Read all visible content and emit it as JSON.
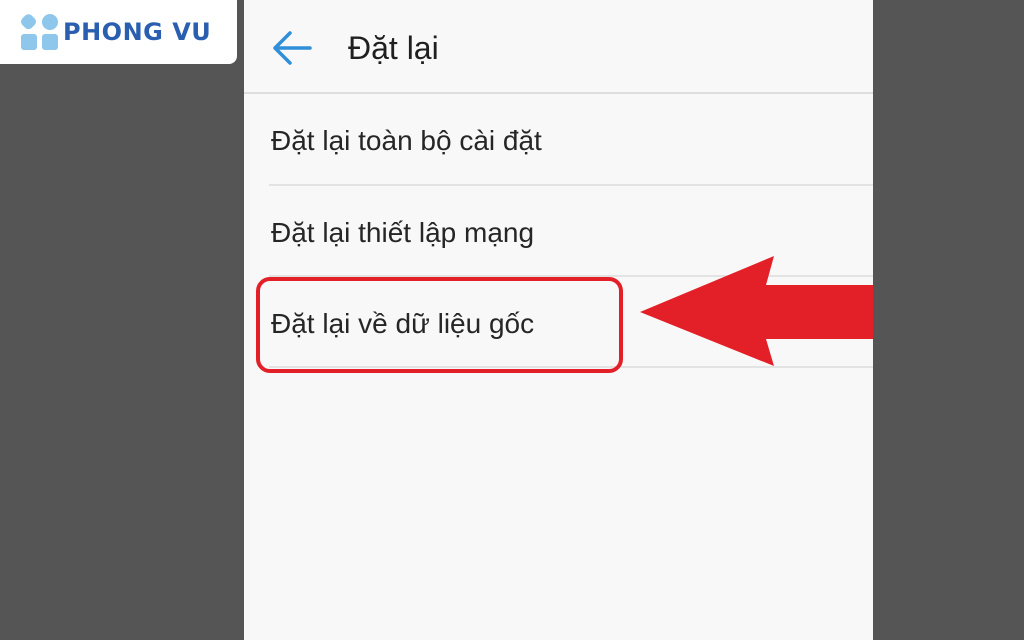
{
  "brand": {
    "name": "PHONG VU",
    "color": "#2a5fb0",
    "accent": "#8ec6ec"
  },
  "header": {
    "back_icon": "arrow-left-icon",
    "title": "Đặt lại"
  },
  "menu": {
    "items": [
      {
        "label": "Đặt lại toàn bộ cài đặt"
      },
      {
        "label": "Đặt lại thiết lập mạng"
      },
      {
        "label": "Đặt lại về dữ liệu gốc"
      }
    ]
  },
  "annotation": {
    "highlight_color": "#e32027",
    "arrow_icon": "arrow-left-icon"
  }
}
